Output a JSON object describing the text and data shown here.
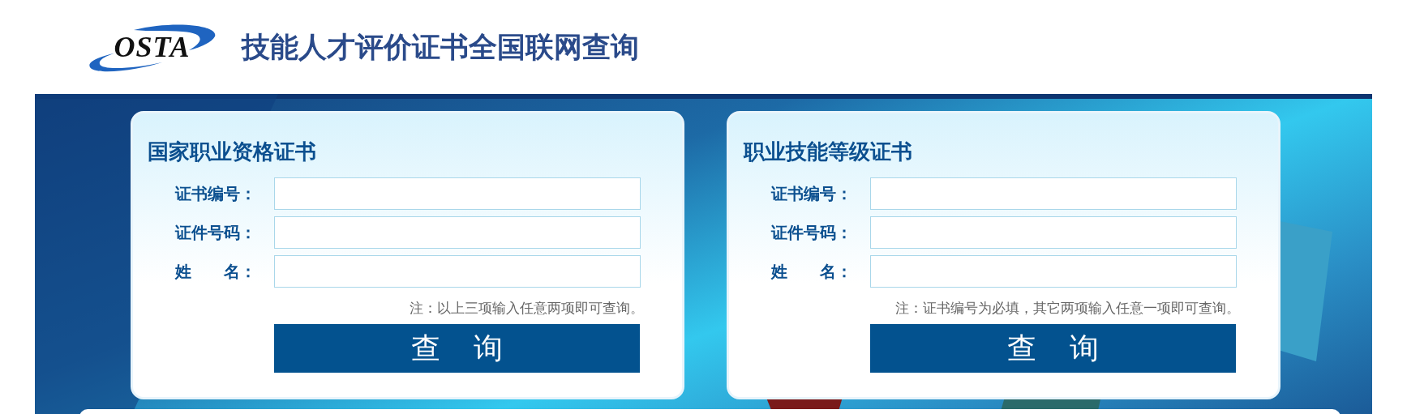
{
  "header": {
    "logo": "OSTA",
    "title": "技能人才评价证书全国联网查询"
  },
  "cards": [
    {
      "title": "国家职业资格证书",
      "fields": [
        {
          "label": "证书编号："
        },
        {
          "label": "证件号码："
        },
        {
          "label": "姓　　名："
        }
      ],
      "note": "注：以上三项输入任意两项即可查询。",
      "button": "查 询"
    },
    {
      "title": "职业技能等级证书",
      "fields": [
        {
          "label": "证书编号："
        },
        {
          "label": "证件号码："
        },
        {
          "label": "姓　　名："
        }
      ],
      "note": "注：证书编号为必填，其它两项输入任意一项即可查询。",
      "button": "查 询"
    }
  ]
}
